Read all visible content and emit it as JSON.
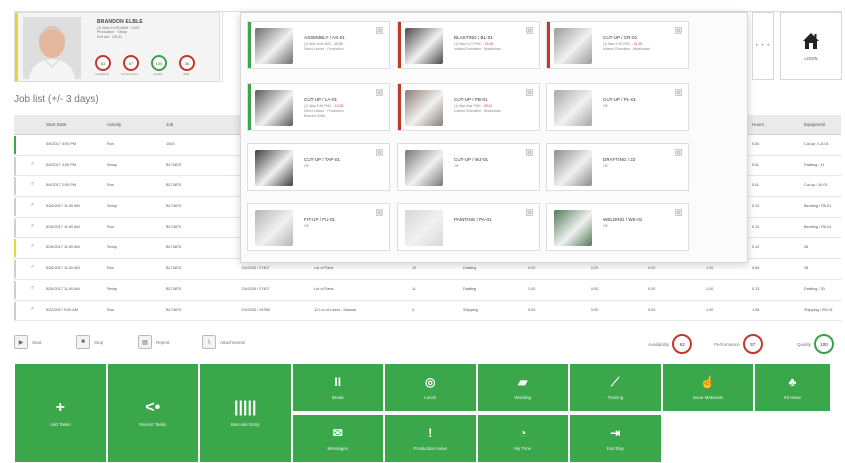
{
  "operator": {
    "name": "BRANDON ELBLE",
    "lines": [
      "(1) Was 10:53 AMD · 0100",
      "Production · Setup",
      "Exit out · Lift 01"
    ],
    "kpis": [
      {
        "label": "Availability",
        "value": "63"
      },
      {
        "label": "Performance",
        "value": "57"
      },
      {
        "label": "Quality",
        "value": "100"
      },
      {
        "label": "OEE",
        "value": "36"
      }
    ]
  },
  "job_list": {
    "title": "Job list (+/- 3 days)",
    "headers": [
      "Start Date",
      "Activity",
      "Job",
      "Hours",
      "Equipment"
    ],
    "rows": [
      {
        "date": "5/5/2017 3:00 PM",
        "activity": "Run",
        "job": "1003",
        "order": "",
        "desc": "",
        "qty": "",
        "op": "",
        "v1": "",
        "v2": "",
        "v3": "",
        "v4": "",
        "hours": "0.80",
        "equipment": "Cut-up / LA-01",
        "bar": "#3aa84a"
      },
      {
        "date": "5/4/2017 4:00 PM",
        "activity": "Setup",
        "job": "B174870",
        "order": "",
        "desc": "",
        "qty": "",
        "op": "",
        "v1": "",
        "v2": "",
        "v3": "",
        "v4": "",
        "hours": "0.0L",
        "equipment": "Drafting / 11",
        "bar": "#cfcfcf"
      },
      {
        "date": "5/4/2017 2:00 PM",
        "activity": "Run",
        "job": "B174870",
        "order": "",
        "desc": "",
        "qty": "",
        "op": "",
        "v1": "",
        "v2": "",
        "v3": "",
        "v4": "",
        "hours": "0.0L",
        "equipment": "Cut-up / W-01",
        "bar": "#cfcfcf"
      },
      {
        "date": "5/26/2017 11:00 AM",
        "activity": "Setup",
        "job": "B174870",
        "order": "",
        "desc": "",
        "qty": "",
        "op": "",
        "v1": "",
        "v2": "",
        "v3": "",
        "v4": "",
        "hours": "0.12",
        "equipment": "Bending / PA-01",
        "bar": "#cfcfcf"
      },
      {
        "date": "5/26/2017 11:00 AM",
        "activity": "Run",
        "job": "B174870",
        "order": "",
        "desc": "",
        "qty": "",
        "op": "",
        "v1": "",
        "v2": "",
        "v3": "",
        "v4": "",
        "hours": "0.12",
        "equipment": "Bending / PA-01",
        "bar": "#cfcfcf"
      },
      {
        "date": "5/26/2017 11:00 AM",
        "activity": "Setup",
        "job": "B174870",
        "order": "",
        "desc": "",
        "qty": "",
        "op": "",
        "v1": "",
        "v2": "",
        "v3": "",
        "v4": "",
        "hours": "0.12",
        "equipment": "28",
        "bar": "#e7d63a"
      },
      {
        "date": "5/26/2017 11:00 AM",
        "activity": "Run",
        "job": "B174870",
        "order": "DU2026 / 27407",
        "desc": "Lot of Parts",
        "qty": "10",
        "op": "Drafting",
        "v1": "0.00",
        "v2": "0.00",
        "v3": "0.00",
        "v4": "1.00",
        "hours": "0.84",
        "equipment": "28",
        "bar": "#cfcfcf"
      },
      {
        "date": "5/26/2017 11:00 AM",
        "activity": "Setup",
        "job": "B174870",
        "order": "DU2026 / 27407",
        "desc": "Lot of Parts",
        "qty": "1L",
        "op": "Drafting",
        "v1": "1.00",
        "v2": "0.00",
        "v3": "0.00",
        "v4": "1.00",
        "hours": "0.13",
        "equipment": "Drafting / 30",
        "bar": "#cfcfcf"
      },
      {
        "date": "5/22/2017 9:00 AM",
        "activity": "Run",
        "job": "B174870",
        "order": "DU2026 / 29758",
        "desc": "12 Lot of Liners - Manual",
        "qty": "4",
        "op": "Shipping",
        "v1": "0.00",
        "v2": "0.00",
        "v3": "0.00",
        "v4": "1.00",
        "hours": "1.08",
        "equipment": "Shipping / SH-01",
        "bar": "#cfcfcf"
      }
    ]
  },
  "toolbar": {
    "buttons": [
      {
        "label": "Start",
        "icon": "play-icon"
      },
      {
        "label": "Stop",
        "icon": "stop-icon"
      },
      {
        "label": "Report",
        "icon": "report-icon"
      },
      {
        "label": "Attachments",
        "icon": "paperclip-icon"
      }
    ],
    "stats": [
      {
        "label": "Availability",
        "value": "63"
      },
      {
        "label": "Performance",
        "value": "57"
      },
      {
        "label": "Quality",
        "value": "100"
      }
    ]
  },
  "tiles": [
    {
      "label": "Add Tasks",
      "icon": "+"
    },
    {
      "label": "Recent Tasks",
      "icon": "<•"
    },
    {
      "label": "Barcode Entry",
      "icon": "|||||"
    },
    {
      "label": "Break",
      "icon": "II"
    },
    {
      "label": "Lunch",
      "icon": "◎"
    },
    {
      "label": "Working",
      "icon": "▰"
    },
    {
      "label": "Training",
      "icon": "⟋"
    },
    {
      "label": "Issue Materials",
      "icon": "☝"
    },
    {
      "label": "Kit Issue",
      "icon": "♣"
    },
    {
      "label": "Messages",
      "icon": "✉"
    },
    {
      "label": "Production Issue",
      "icon": "!"
    },
    {
      "label": "My Time",
      "icon": "◔"
    },
    {
      "label": "End Day",
      "icon": "⇥"
    }
  ],
  "machines": [
    {
      "name": "ASSEMBLY / AS-01",
      "line1": "(1) Was Urdt 4MC - 10:00",
      "line2": "Direct Labour · Production",
      "status": "#3aa84a",
      "thumb": "#6d6d6d"
    },
    {
      "name": "BLASTING / BL-01",
      "line1": "(1) Was 4:07 PMC - 15:25",
      "line2": "Indirect Downtime · Breakdown",
      "status": "#c0392b",
      "thumb": "#4a4a4a"
    },
    {
      "name": "CUT-UP / CR-01",
      "line1": "(1) Was 4:33 PMC - 01:25",
      "line2": "Indirect Downtime · Breakdown",
      "status": "#c0392b",
      "thumb": "#9a9a9a"
    },
    {
      "name": "CUT-UP / LA-01",
      "line1": "(1) Was 4:48 PMC - 10:23",
      "line2": "Direct Labour · Production",
      "line3": "Brandon Elble",
      "status": "#3aa84a",
      "thumb": "#5a5a5a"
    },
    {
      "name": "CUT-UP / PB-01",
      "line1": "(1) Was Mar PMC - 09:11",
      "line2": "Indirect Downtime · Breakdown",
      "status": "#c0392b",
      "thumb": "#8a7d73"
    },
    {
      "name": "CUT-UP / PL-01",
      "line1": "Off",
      "line2": "",
      "status": "#ffffff",
      "thumb": "#a7a7a7"
    },
    {
      "name": "CUT-UP / TAP-01",
      "line1": "Off",
      "line2": "",
      "status": "#ffffff",
      "thumb": "#3e3e3e"
    },
    {
      "name": "CUT-UP / WJ-01",
      "line1": "Off",
      "line2": "",
      "status": "#ffffff",
      "thumb": "#777777"
    },
    {
      "name": "DRAFTING / 22",
      "line1": "Off",
      "line2": "",
      "status": "#ffffff",
      "thumb": "#8c8c8c"
    },
    {
      "name": "FIT-UP / FU-01",
      "line1": "Off",
      "line2": "",
      "status": "#ffffff",
      "thumb": "#b5b5b5"
    },
    {
      "name": "PAINTING / PA-01",
      "line1": "",
      "line2": "",
      "status": "#ffffff",
      "thumb": "#d7d7d7"
    },
    {
      "name": "WELDING / WE-01",
      "line1": "Off",
      "line2": "",
      "status": "#ffffff",
      "thumb": "#4f7a55"
    }
  ],
  "more_label": "• • •",
  "login_label": "LOGIN",
  "colors": {
    "green": "#3aa84a",
    "red": "#c0392b",
    "yellow": "#e7d63a"
  }
}
